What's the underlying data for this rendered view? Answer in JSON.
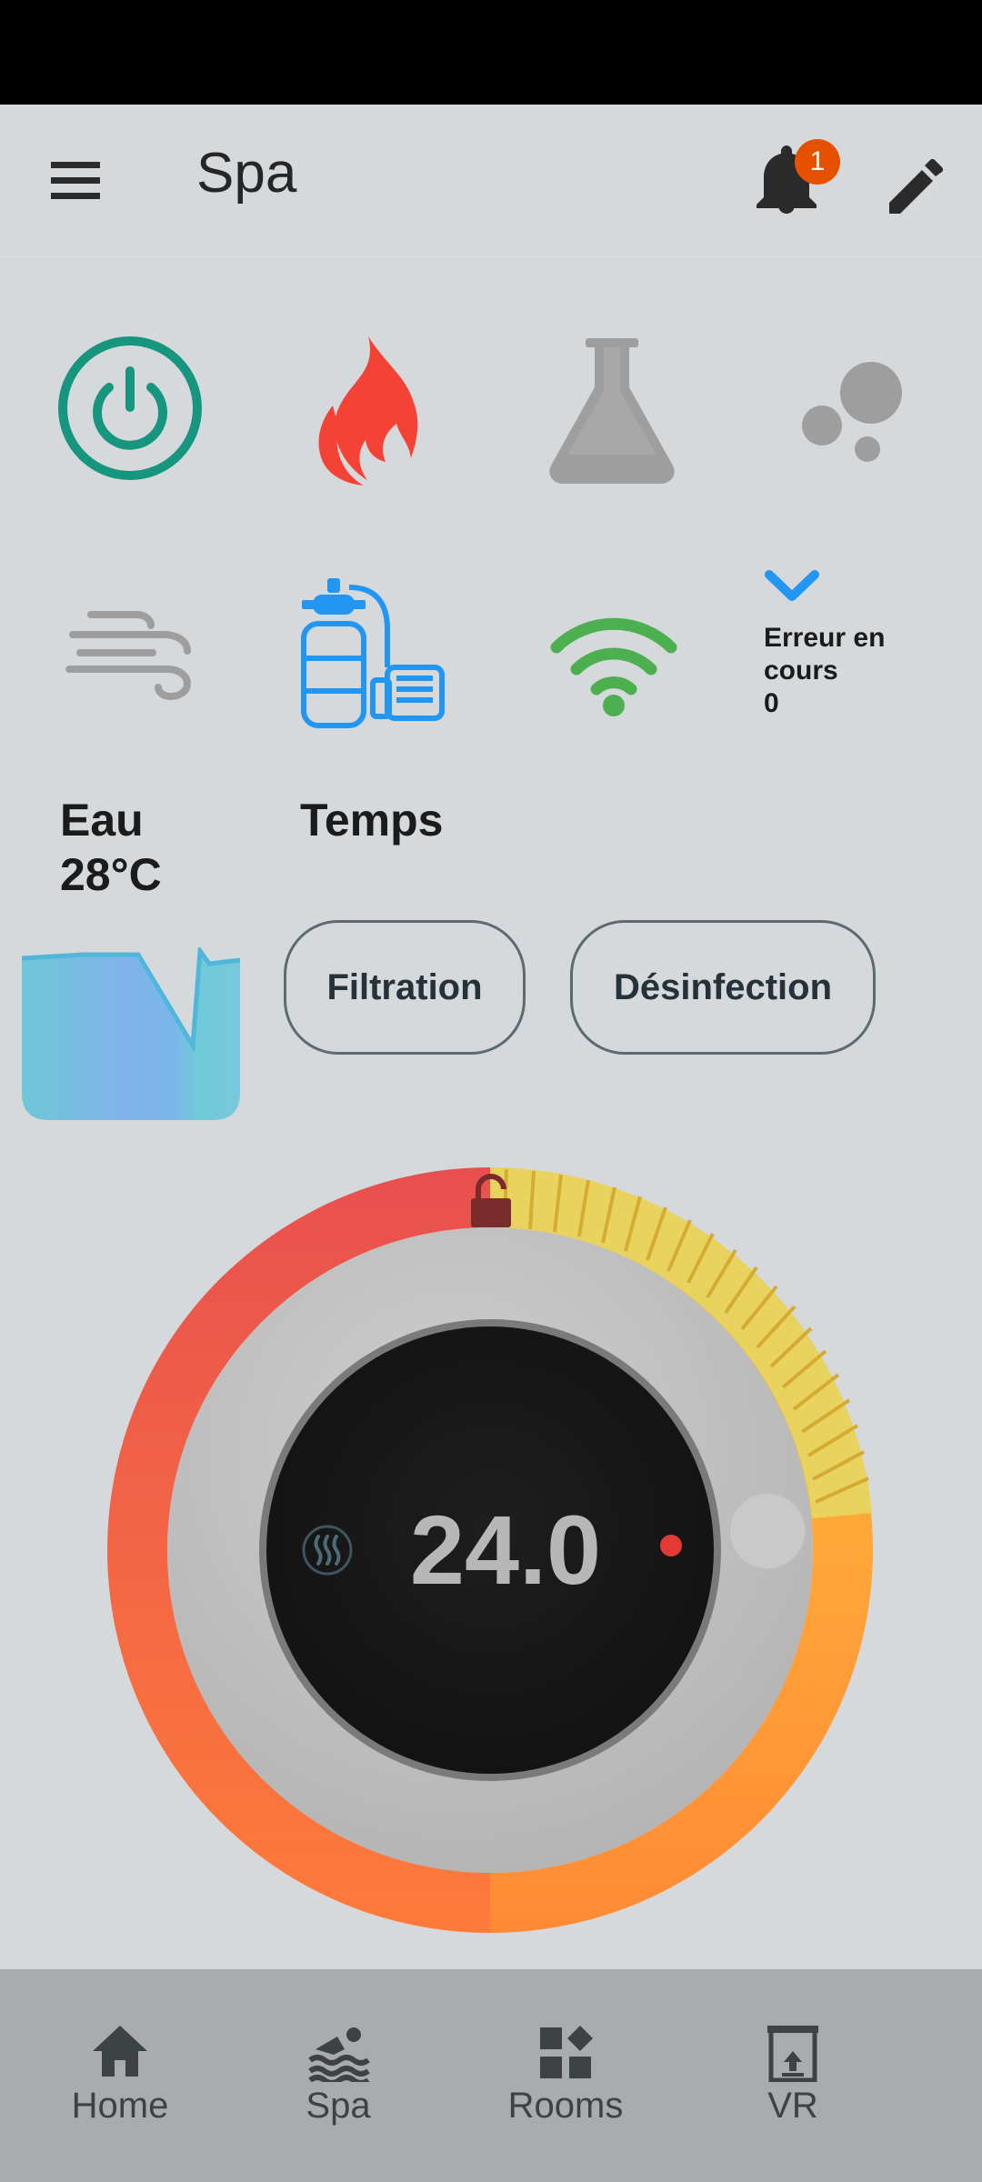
{
  "appbar": {
    "title": "Spa",
    "notification_count": "1"
  },
  "status": {
    "error_label": "Erreur en cours",
    "error_value": "0"
  },
  "water": {
    "label": "Eau",
    "temperature": "28°C"
  },
  "weather": {
    "label": "Temps"
  },
  "buttons": {
    "filtration": "Filtration",
    "disinfection": "Désinfection"
  },
  "thermostat": {
    "value": "24.0"
  },
  "nav": {
    "home": "Home",
    "spa": "Spa",
    "rooms": "Rooms",
    "vr": "VR"
  },
  "colors": {
    "power": "#16967f",
    "flame": "#f44336",
    "wifi": "#4caf50",
    "pump": "#2196f3",
    "badge": "#e65100",
    "ring_start": "#e8504f",
    "ring_end": "#ffa726"
  },
  "icons": [
    "menu-icon",
    "bell-icon",
    "pencil-icon",
    "power-icon",
    "flame-icon",
    "flask-icon",
    "bubbles-icon",
    "wind-icon",
    "pool-pump-icon",
    "wifi-icon",
    "chevron-down-icon",
    "water-tank-icon",
    "lock-open-icon",
    "heat-icon",
    "home-icon",
    "swim-icon",
    "widgets-icon",
    "projector-screen-icon"
  ]
}
